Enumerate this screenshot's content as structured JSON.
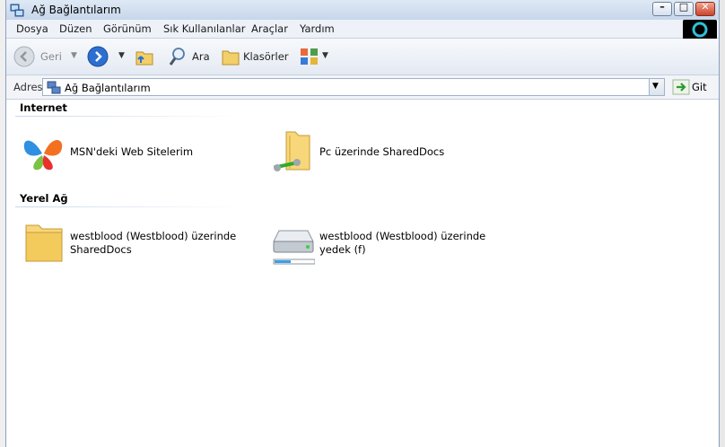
{
  "window": {
    "title": "Ağ Bağlantılarım"
  },
  "menu": [
    "Dosya",
    "Düzen",
    "Görünüm",
    "Sık Kullanılanlar",
    "Araçlar",
    "Yardım"
  ],
  "toolbar": {
    "back": "Geri",
    "search": "Ara",
    "folders": "Klasörler"
  },
  "address": {
    "label": "Adres",
    "value": "Ağ Bağlantılarım",
    "go": "Git"
  },
  "groups": [
    {
      "header": "Internet",
      "items": [
        {
          "label": "MSN'deki Web Sitelerim",
          "icon": "msn-butterfly-icon"
        },
        {
          "label": "Pc üzerinde SharedDocs",
          "icon": "network-folder-icon"
        }
      ]
    },
    {
      "header": "Yerel Ağ",
      "items": [
        {
          "label": "westblood (Westblood) üzerinde SharedDocs",
          "icon": "folder-icon"
        },
        {
          "label": "westblood (Westblood) üzerinde yedek (f)",
          "icon": "network-drive-icon"
        }
      ]
    }
  ],
  "colors": {
    "title_bar": "#c6d6ea",
    "accent": "#1f5fbf"
  }
}
